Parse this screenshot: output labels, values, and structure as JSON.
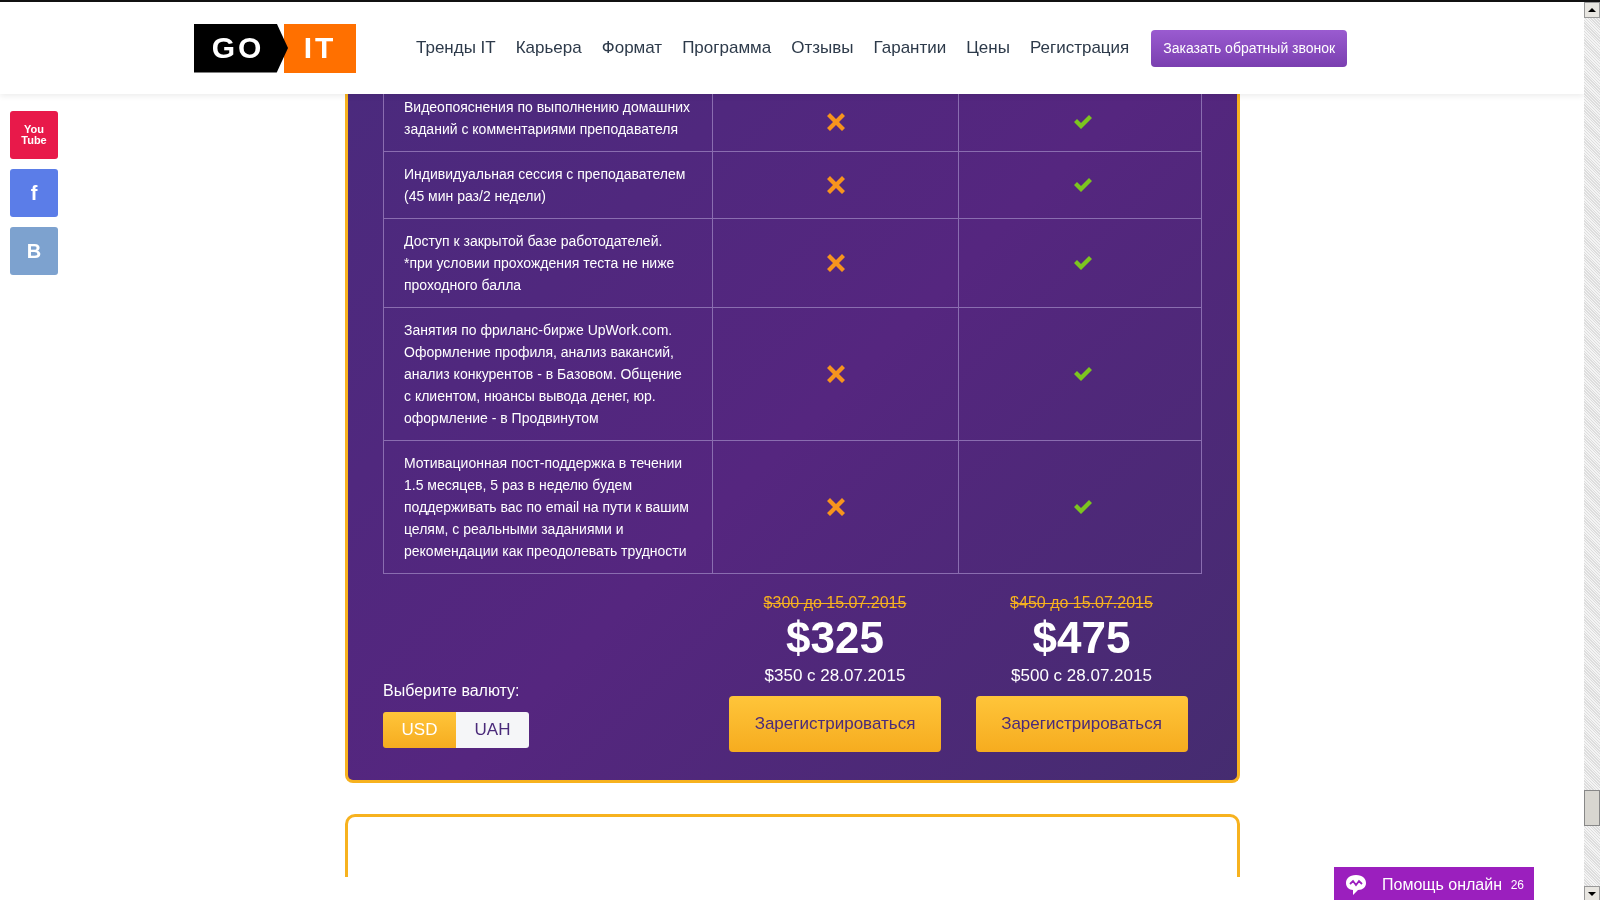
{
  "header": {
    "logo": {
      "left": "GO",
      "right": "IT"
    },
    "nav": [
      "Тренды IT",
      "Карьера",
      "Формат",
      "Программа",
      "Отзывы",
      "Гарантии",
      "Цены",
      "Регистрация"
    ],
    "callback_button": "Заказать обратный звонок"
  },
  "social": [
    {
      "kind": "youtube",
      "label": "You\nTube"
    },
    {
      "kind": "facebook",
      "label": "f"
    },
    {
      "kind": "vk",
      "label": "B"
    }
  ],
  "table": {
    "rows": [
      {
        "feature": "Видеопояснения по выполнению домашних заданий с комментариями преподавателя",
        "plans": [
          {
            "included": false
          },
          {
            "included": true
          }
        ]
      },
      {
        "feature": "Индивидуальная сессия с преподавателем (45 мин раз/2 недели)",
        "plans": [
          {
            "included": false
          },
          {
            "included": true
          }
        ]
      },
      {
        "feature": "Доступ к закрытой базе работодателей. *при условии прохождения теста не ниже проходного балла",
        "plans": [
          {
            "included": false
          },
          {
            "included": true
          }
        ]
      },
      {
        "feature": "Занятия по фриланс-бирже UpWork.com. Оформление профиля, анализ вакансий, анализ конкурентов - в Базовом. Общение с клиентом, нюансы вывода денег, юр. оформление - в Продвинутом",
        "plans": [
          {
            "included": false
          },
          {
            "included": true
          }
        ]
      },
      {
        "feature": "Мотивационная пост-поддержка в течении 1.5 месяцев, 5 раз в неделю будем поддерживать вас по email на пути к вашим целям, с реальными заданиями и рекомендации как преодолевать трудности",
        "plans": [
          {
            "included": false
          },
          {
            "included": true
          }
        ]
      }
    ]
  },
  "currency": {
    "label": "Выберите валюту:",
    "options": [
      {
        "label": "USD",
        "selected": true
      },
      {
        "label": "UAH",
        "selected": false
      }
    ]
  },
  "prices": [
    {
      "old": "$300 до 15.07.2015",
      "price": "$325",
      "later": "$350 с 28.07.2015",
      "button": "Зарегистрироваться"
    },
    {
      "old": "$450 до 15.07.2015",
      "price": "$475",
      "later": "$500 с 28.07.2015",
      "button": "Зарегистрироваться"
    }
  ],
  "chat": {
    "label": "Помощь онлайн",
    "count": "26"
  }
}
